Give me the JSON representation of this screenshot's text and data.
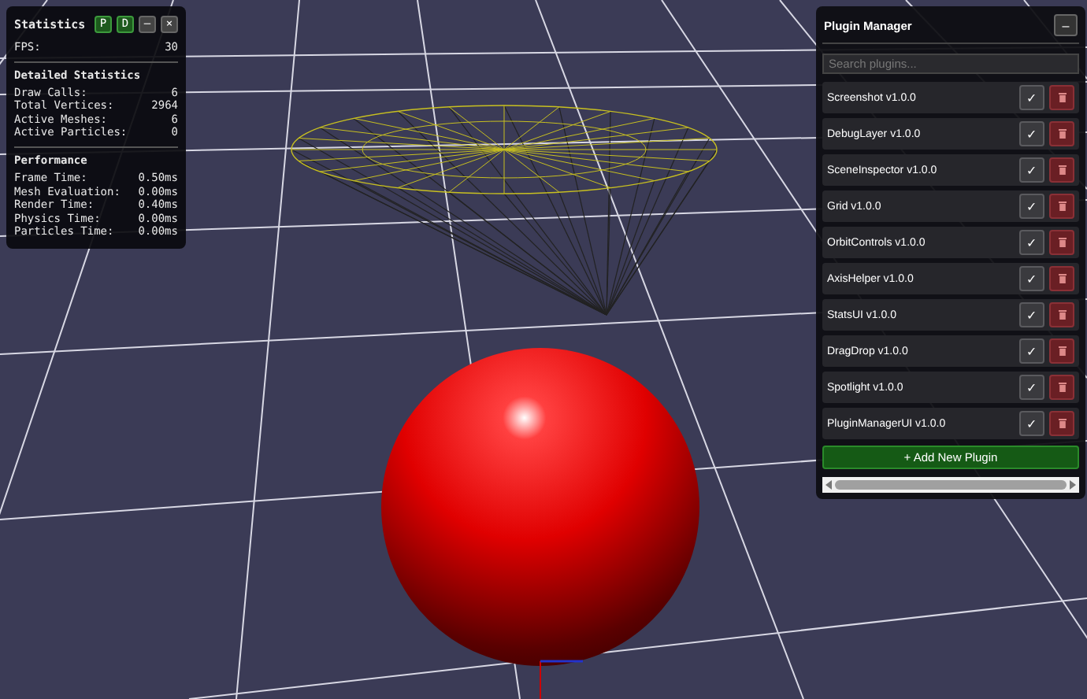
{
  "stats_panel": {
    "title": "Statistics",
    "header_buttons": [
      {
        "label": "P",
        "kind": "toggle"
      },
      {
        "label": "D",
        "kind": "toggle"
      },
      {
        "label": "–",
        "kind": "window"
      },
      {
        "label": "×",
        "kind": "window"
      }
    ],
    "summary": [
      {
        "label": "FPS:",
        "value": "30"
      }
    ],
    "sections": [
      {
        "title": "Detailed Statistics",
        "rows": [
          {
            "label": "Draw Calls:",
            "value": "6"
          },
          {
            "label": "Total Vertices:",
            "value": "2964"
          },
          {
            "label": "Active Meshes:",
            "value": "6"
          },
          {
            "label": "Active Particles:",
            "value": "0"
          }
        ]
      },
      {
        "title": "Performance",
        "rows": [
          {
            "label": "Frame Time:",
            "value": "0.50ms"
          },
          {
            "label": "Mesh Evaluation:",
            "value": "0.00ms"
          },
          {
            "label": "Render Time:",
            "value": "0.40ms"
          },
          {
            "label": "Physics Time:",
            "value": "0.00ms"
          },
          {
            "label": "Particles Time:",
            "value": "0.00ms"
          }
        ]
      }
    ]
  },
  "plugin_manager": {
    "title": "Plugin Manager",
    "minimize_button": "–",
    "search": {
      "placeholder": "Search plugins..."
    },
    "plugins": [
      {
        "name": "Screenshot v1.0.0",
        "toggle": "✓"
      },
      {
        "name": "DebugLayer v1.0.0",
        "toggle": "✓"
      },
      {
        "name": "SceneInspector v1.0.0",
        "toggle": "✓"
      },
      {
        "name": "Grid v1.0.0",
        "toggle": "✓"
      },
      {
        "name": "OrbitControls v1.0.0",
        "toggle": "✓"
      },
      {
        "name": "AxisHelper v1.0.0",
        "toggle": "✓"
      },
      {
        "name": "StatsUI v1.0.0",
        "toggle": "✓"
      },
      {
        "name": "DragDrop v1.0.0",
        "toggle": "✓"
      },
      {
        "name": "Spotlight v1.0.0",
        "toggle": "✓"
      },
      {
        "name": "PluginManagerUI v1.0.0",
        "toggle": "✓"
      }
    ],
    "add_button": "+ Add New Plugin"
  }
}
